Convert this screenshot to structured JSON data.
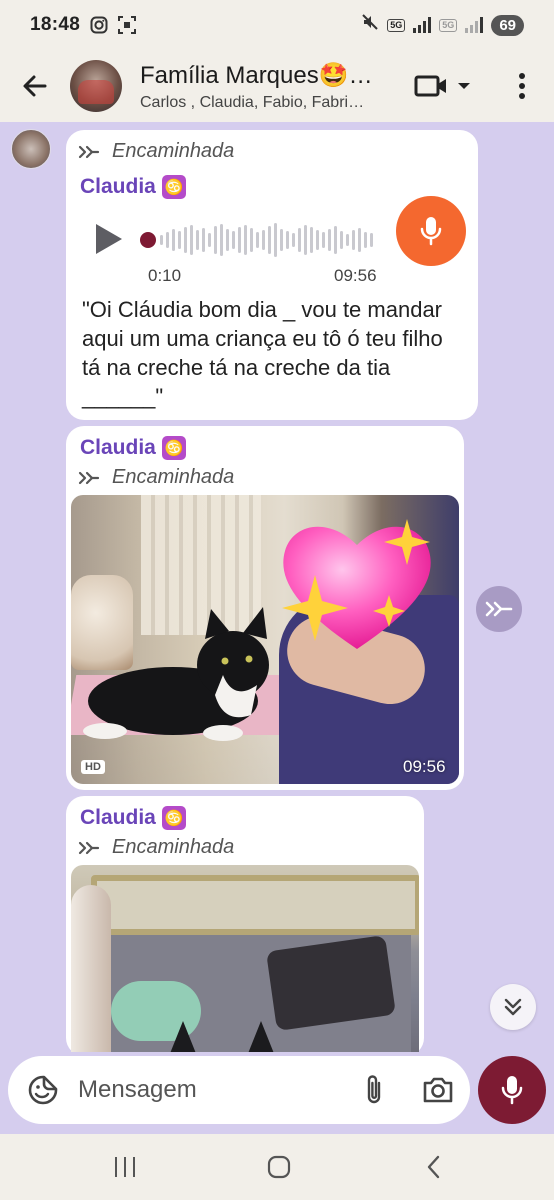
{
  "status_bar": {
    "time": "18:48",
    "network_1": "5G",
    "network_2": "5G",
    "battery": "69",
    "icons": [
      "instagram-icon",
      "screen-record-icon",
      "mute-icon",
      "wifi-5g-icon",
      "signal-icon",
      "signal-icon"
    ]
  },
  "header": {
    "title": "Família Marques🤩…",
    "subtitle": "Carlos , Claudia, Fabio, Fabri…",
    "icons": [
      "back-arrow-icon",
      "video-call-icon",
      "dropdown-icon",
      "more-icon"
    ]
  },
  "messages": [
    {
      "type": "audio",
      "forwarded_label": "Encaminhada",
      "sender": "Claudia",
      "zodiac": "♋",
      "elapsed": "0:10",
      "time": "09:56",
      "transcript": "\"Oi Cláudia bom dia _ vou te mandar aqui um uma criança eu tô ó teu filho tá na creche tá na creche da tia ______\""
    },
    {
      "type": "photo",
      "sender": "Claudia",
      "zodiac": "♋",
      "forwarded_label": "Encaminhada",
      "badge": "HD",
      "time": "09:56"
    },
    {
      "type": "photo",
      "sender": "Claudia",
      "zodiac": "♋",
      "forwarded_label": "Encaminhada"
    }
  ],
  "composer": {
    "placeholder": "Mensagem"
  },
  "colors": {
    "chat_background": "#d5cdee",
    "sender_name": "#6a45b8",
    "audio_mic": "#f4682f",
    "send_mic": "#7d1b33",
    "bars": "#f2efe9"
  }
}
